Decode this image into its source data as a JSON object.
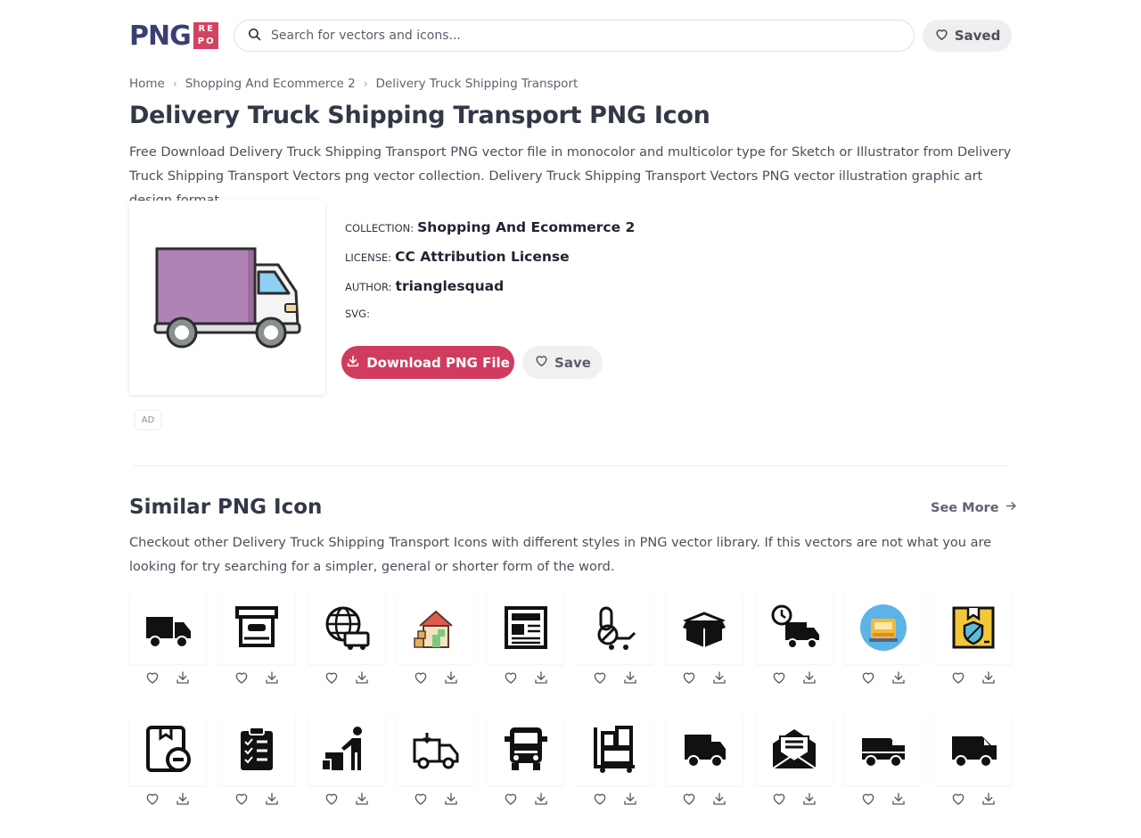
{
  "header": {
    "logo_main": "PNG",
    "logo_badge": [
      "RE",
      "PO"
    ],
    "search_placeholder": "Search for vectors and icons...",
    "saved_label": "Saved"
  },
  "breadcrumb": [
    "Home",
    "Shopping And Ecommerce 2",
    "Delivery Truck Shipping Transport"
  ],
  "page_title": "Delivery Truck Shipping Transport PNG Icon",
  "description": "Free Download Delivery Truck Shipping Transport PNG vector file in monocolor and multicolor type for Sketch or Illustrator from Delivery Truck Shipping Transport Vectors png vector collection. Delivery Truck Shipping Transport Vectors PNG vector illustration graphic art design format.",
  "meta": {
    "collection_key": "COLLECTION:",
    "collection_val": "Shopping And Ecommerce 2",
    "license_key": "LICENSE:",
    "license_val": "CC Attribution License",
    "author_key": "AUTHOR:",
    "author_val": "trianglesquad",
    "svg_key": "SVG:"
  },
  "actions": {
    "download_label": "Download PNG File",
    "save_label": "Save"
  },
  "ad_label": "AD",
  "similar": {
    "title": "Similar PNG Icon",
    "see_more": "See More",
    "description": "Checkout other Delivery Truck Shipping Transport Icons with different styles in PNG vector library. If this vectors are not what you are looking for try searching for a simpler, general or shorter form of the word.",
    "row1": [
      "truck-icon",
      "archive-box-icon",
      "global-delivery-icon",
      "house-delivery-icon",
      "newspaper-icon",
      "hand-truck-icon",
      "open-box-icon",
      "fast-delivery-truck-icon",
      "truck-badge-icon",
      "protected-package-icon"
    ],
    "row2": [
      "package-remove-icon",
      "clipboard-checklist-icon",
      "courier-boxes-icon",
      "delivery-van-outline-icon",
      "truck-front-icon",
      "warehouse-cart-icon",
      "cargo-van-icon",
      "envelope-open-icon",
      "van-side-icon",
      "van-icon"
    ]
  },
  "colors": {
    "brand": "#3a3f72",
    "accent": "#d13b5e",
    "truck_body": "#b083b6"
  }
}
